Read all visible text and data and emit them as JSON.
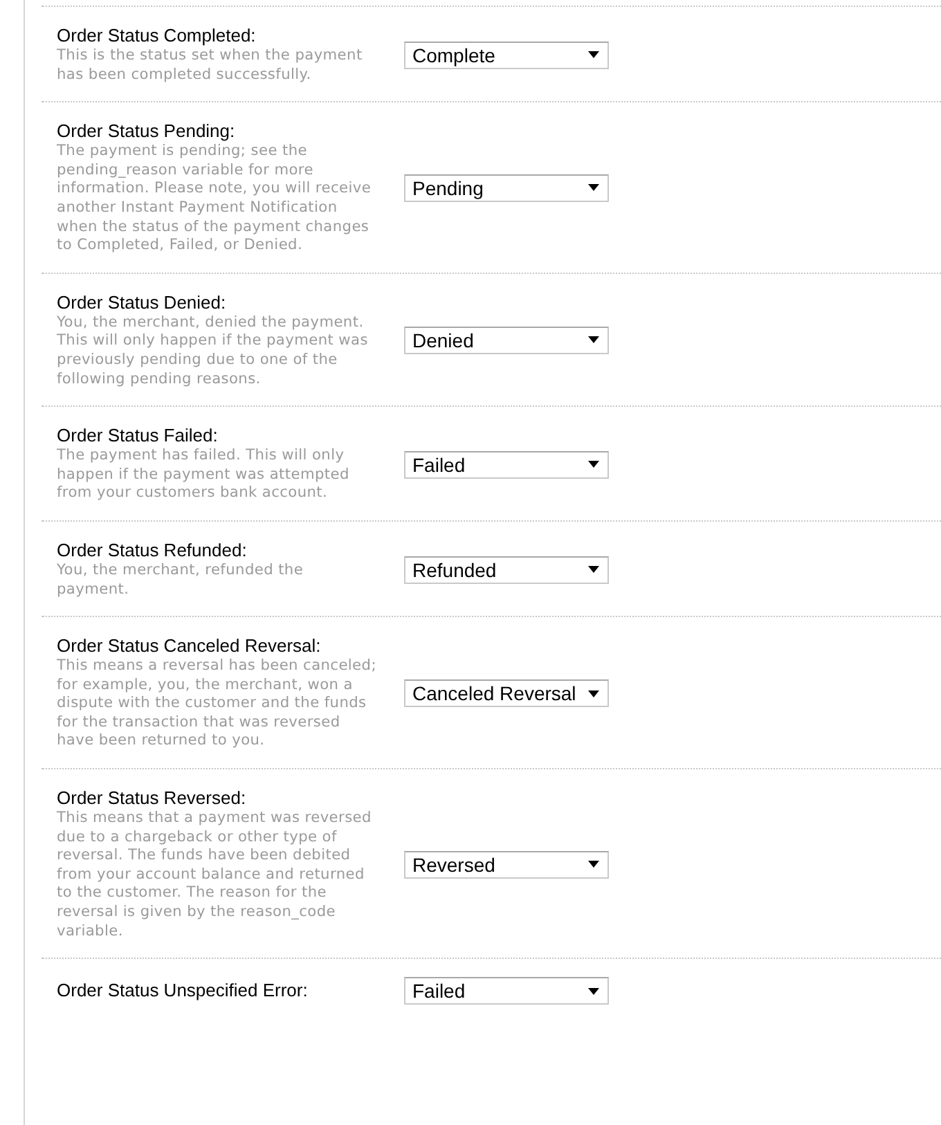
{
  "settings": [
    {
      "label": "Order Status Completed:",
      "description": "This is the status set when the payment has been completed successfully.",
      "value": "Complete"
    },
    {
      "label": "Order Status Pending:",
      "description": "The payment is pending; see the pending_reason variable for more information. Please note, you will receive another Instant Payment Notification when the status of the payment changes to Completed, Failed, or Denied.",
      "value": "Pending"
    },
    {
      "label": "Order Status Denied:",
      "description": "You, the merchant, denied the payment. This will only happen if the payment was previously pending due to one of the following pending reasons.",
      "value": "Denied"
    },
    {
      "label": "Order Status Failed:",
      "description": "The payment has failed. This will only happen if the payment was attempted from your customers bank account.",
      "value": "Failed"
    },
    {
      "label": "Order Status Refunded:",
      "description": "You, the merchant, refunded the payment.",
      "value": "Refunded"
    },
    {
      "label": "Order Status Canceled Reversal:",
      "description": "This means a reversal has been canceled; for example, you, the merchant, won a dispute with the customer and the funds for the transaction that was reversed have been returned to you.",
      "value": "Canceled Reversal"
    },
    {
      "label": "Order Status Reversed:",
      "description": "This means that a payment was reversed due to a chargeback or other type of reversal. The funds have been debited from your account balance and returned to the customer. The reason for the reversal is given by the reason_code variable.",
      "value": "Reversed"
    },
    {
      "label": "Order Status Unspecified Error:",
      "value": "Failed"
    }
  ]
}
